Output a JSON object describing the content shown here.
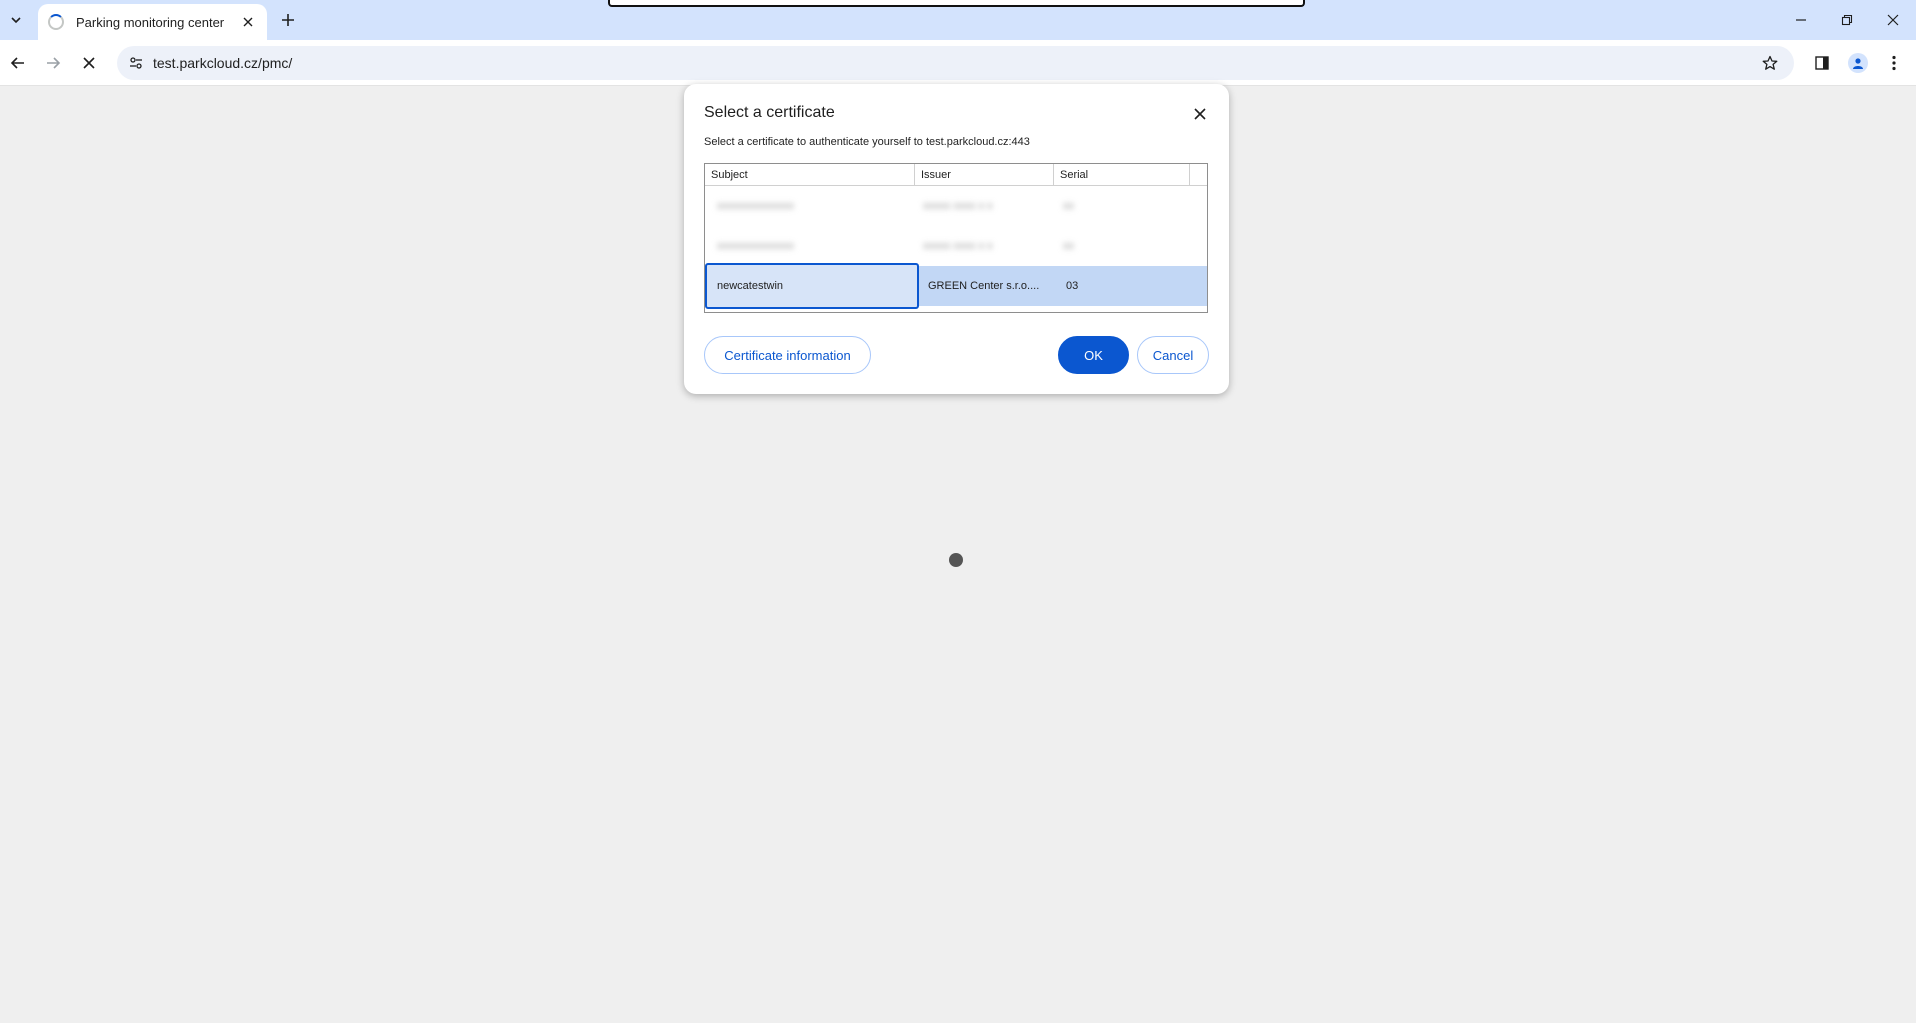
{
  "browser": {
    "tab": {
      "title": "Parking monitoring center"
    },
    "omnibox": {
      "url": "test.parkcloud.cz/pmc/"
    }
  },
  "dialog": {
    "title": "Select a certificate",
    "description": "Select a certificate to authenticate yourself to test.parkcloud.cz:443",
    "columns": [
      "Subject",
      "Issuer",
      "Serial"
    ],
    "rows": [
      {
        "subject": "xxxxxxxxxxxxxx",
        "issuer": "xxxxx xxxx x x",
        "serial": "xx"
      },
      {
        "subject": "xxxxxxxxxxxxxx",
        "issuer": "xxxxx xxxx x x",
        "serial": "xx"
      },
      {
        "subject": "newcatestwin",
        "issuer": "GREEN Center s.r.o....",
        "serial": "03"
      }
    ],
    "buttons": {
      "info": "Certificate information",
      "ok": "OK",
      "cancel": "Cancel"
    }
  },
  "colors": {
    "accent": "#0b57d0",
    "selection": "#c2d7f5",
    "tabstrip": "#d3e3fd",
    "page_background": "#efefef"
  }
}
